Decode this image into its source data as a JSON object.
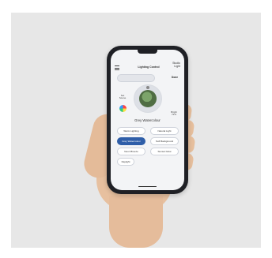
{
  "app": {
    "title": "Lighting Control",
    "header_right": "Studio\nLight",
    "done_label": "Done",
    "left_label": "Set\nScene",
    "right_label": "Bright\n72%",
    "mode_title": "Grey Watercolour"
  },
  "buttons": [
    {
      "label": "Warm Lighting",
      "selected": false
    },
    {
      "label": "Natural Light",
      "selected": false
    },
    {
      "label": "Grey Watercolour",
      "selected": true
    },
    {
      "label": "Soft Background",
      "selected": false
    },
    {
      "label": "Neon Breeze",
      "selected": false
    },
    {
      "label": "Sunset Glow",
      "selected": false
    },
    {
      "label": "Daylight",
      "selected": false
    }
  ]
}
